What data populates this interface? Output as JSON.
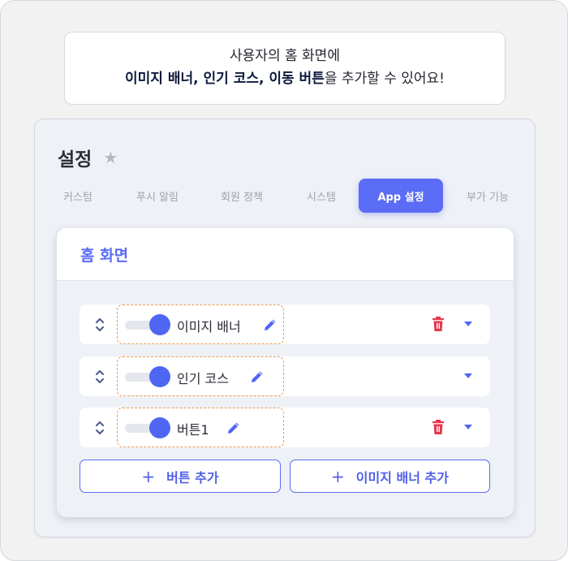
{
  "callout": {
    "line1": "사용자의 홈 화면에",
    "line2_bold": "이미지 배너, 인기 코스, 이동 버튼",
    "line2_rest": "을 추가할 수 있어요!"
  },
  "settings": {
    "title": "설정",
    "star_icon": "★",
    "tabs": [
      {
        "label": "커스텀",
        "active": false
      },
      {
        "label": "푸시 알림",
        "active": false
      },
      {
        "label": "회원 정책",
        "active": false
      },
      {
        "label": "시스템",
        "active": false
      },
      {
        "label": "App 설정",
        "active": true
      },
      {
        "label": "부가 기능",
        "active": false
      }
    ]
  },
  "home": {
    "title": "홈 화면",
    "items": [
      {
        "label": "이미지 배너",
        "enabled": true,
        "deletable": true
      },
      {
        "label": "인기 코스",
        "enabled": true,
        "deletable": false
      },
      {
        "label": "버튼1",
        "enabled": true,
        "deletable": true
      }
    ],
    "add_button_label": "버튼 추가",
    "add_banner_label": "이미지 배너 추가",
    "plus_icon": "+"
  },
  "colors": {
    "accent": "#5b6cf6",
    "toggle_on": "#4f66f3",
    "delete": "#e8364d",
    "dashed_highlight": "#f29a4a"
  },
  "icons": [
    "star-icon",
    "drag-handle-icon",
    "pencil-icon",
    "trash-icon",
    "caret-down-icon",
    "plus-icon"
  ]
}
